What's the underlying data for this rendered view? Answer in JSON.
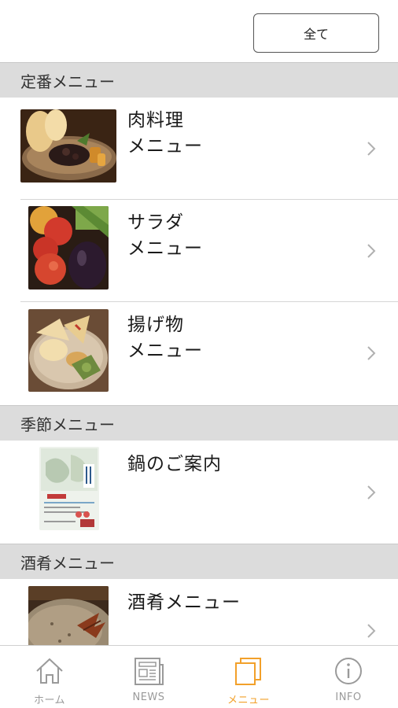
{
  "topbar": {
    "all_label": "全て"
  },
  "sections": [
    {
      "title": "定番メニュー",
      "items": [
        {
          "line1": "肉料理",
          "line2": "メニュー"
        },
        {
          "line1": "サラダ",
          "line2": "メニュー"
        },
        {
          "line1": "揚げ物",
          "line2": "メニュー"
        }
      ]
    },
    {
      "title": "季節メニュー",
      "items": [
        {
          "line1": "鍋のご案内",
          "line2": ""
        }
      ]
    },
    {
      "title": "酒肴メニュー",
      "items": [
        {
          "line1": "酒肴メニュー",
          "line2": ""
        }
      ]
    }
  ],
  "tabbar": {
    "tabs": [
      {
        "label": "ホーム",
        "icon": "home-icon",
        "active": false
      },
      {
        "label": "NEWS",
        "icon": "newspaper-icon",
        "active": false
      },
      {
        "label": "メニュー",
        "icon": "menu-book-icon",
        "active": true
      },
      {
        "label": "INFO",
        "icon": "info-icon",
        "active": false
      }
    ]
  },
  "colors": {
    "accent": "#f2a02a",
    "section_bg": "#dcdcdc",
    "tab_inactive": "#9a9a9a"
  }
}
